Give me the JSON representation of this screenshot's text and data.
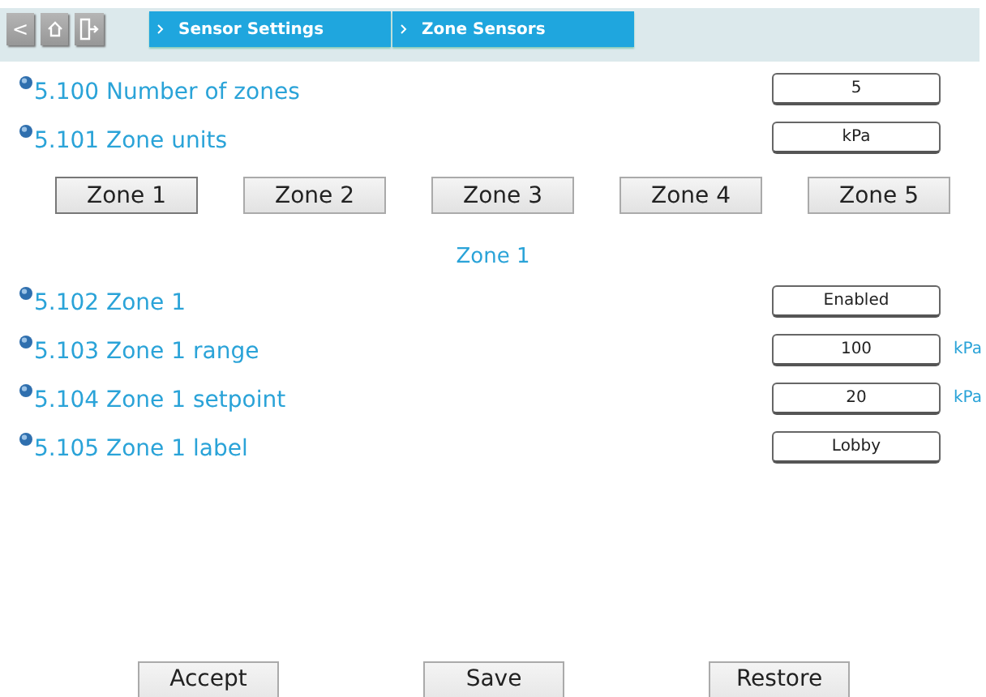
{
  "toolbar": {
    "buttons": [
      {
        "kind": "back",
        "label": "<"
      },
      {
        "kind": "home"
      },
      {
        "kind": "exit"
      }
    ],
    "breadcrumbs": [
      "Sensor Settings",
      "Zone Sensors"
    ]
  },
  "settings": [
    {
      "label": "5.100 Number of zones",
      "value": "5"
    },
    {
      "label": "5.101 Zone units",
      "value": "kPa"
    }
  ],
  "zone_tabs": [
    {
      "label": "Zone 1",
      "selected": true
    },
    {
      "label": "Zone 2",
      "selected": false
    },
    {
      "label": "Zone 3",
      "selected": false
    },
    {
      "label": "Zone 4",
      "selected": false
    },
    {
      "label": "Zone 5",
      "selected": false
    }
  ],
  "zone_title": "Zone 1",
  "zone_settings": [
    {
      "label": "5.102 Zone 1",
      "value": "Enabled"
    },
    {
      "label": "5.103 Zone 1 range",
      "value": "100",
      "unit": "kPa"
    },
    {
      "label": "5.104 Zone 1 setpoint",
      "value": "20",
      "unit": "kPa"
    },
    {
      "label": "5.105 Zone 1 label",
      "value": "Lobby"
    }
  ],
  "buttons": [
    "Accept",
    "Save",
    "Restore"
  ]
}
